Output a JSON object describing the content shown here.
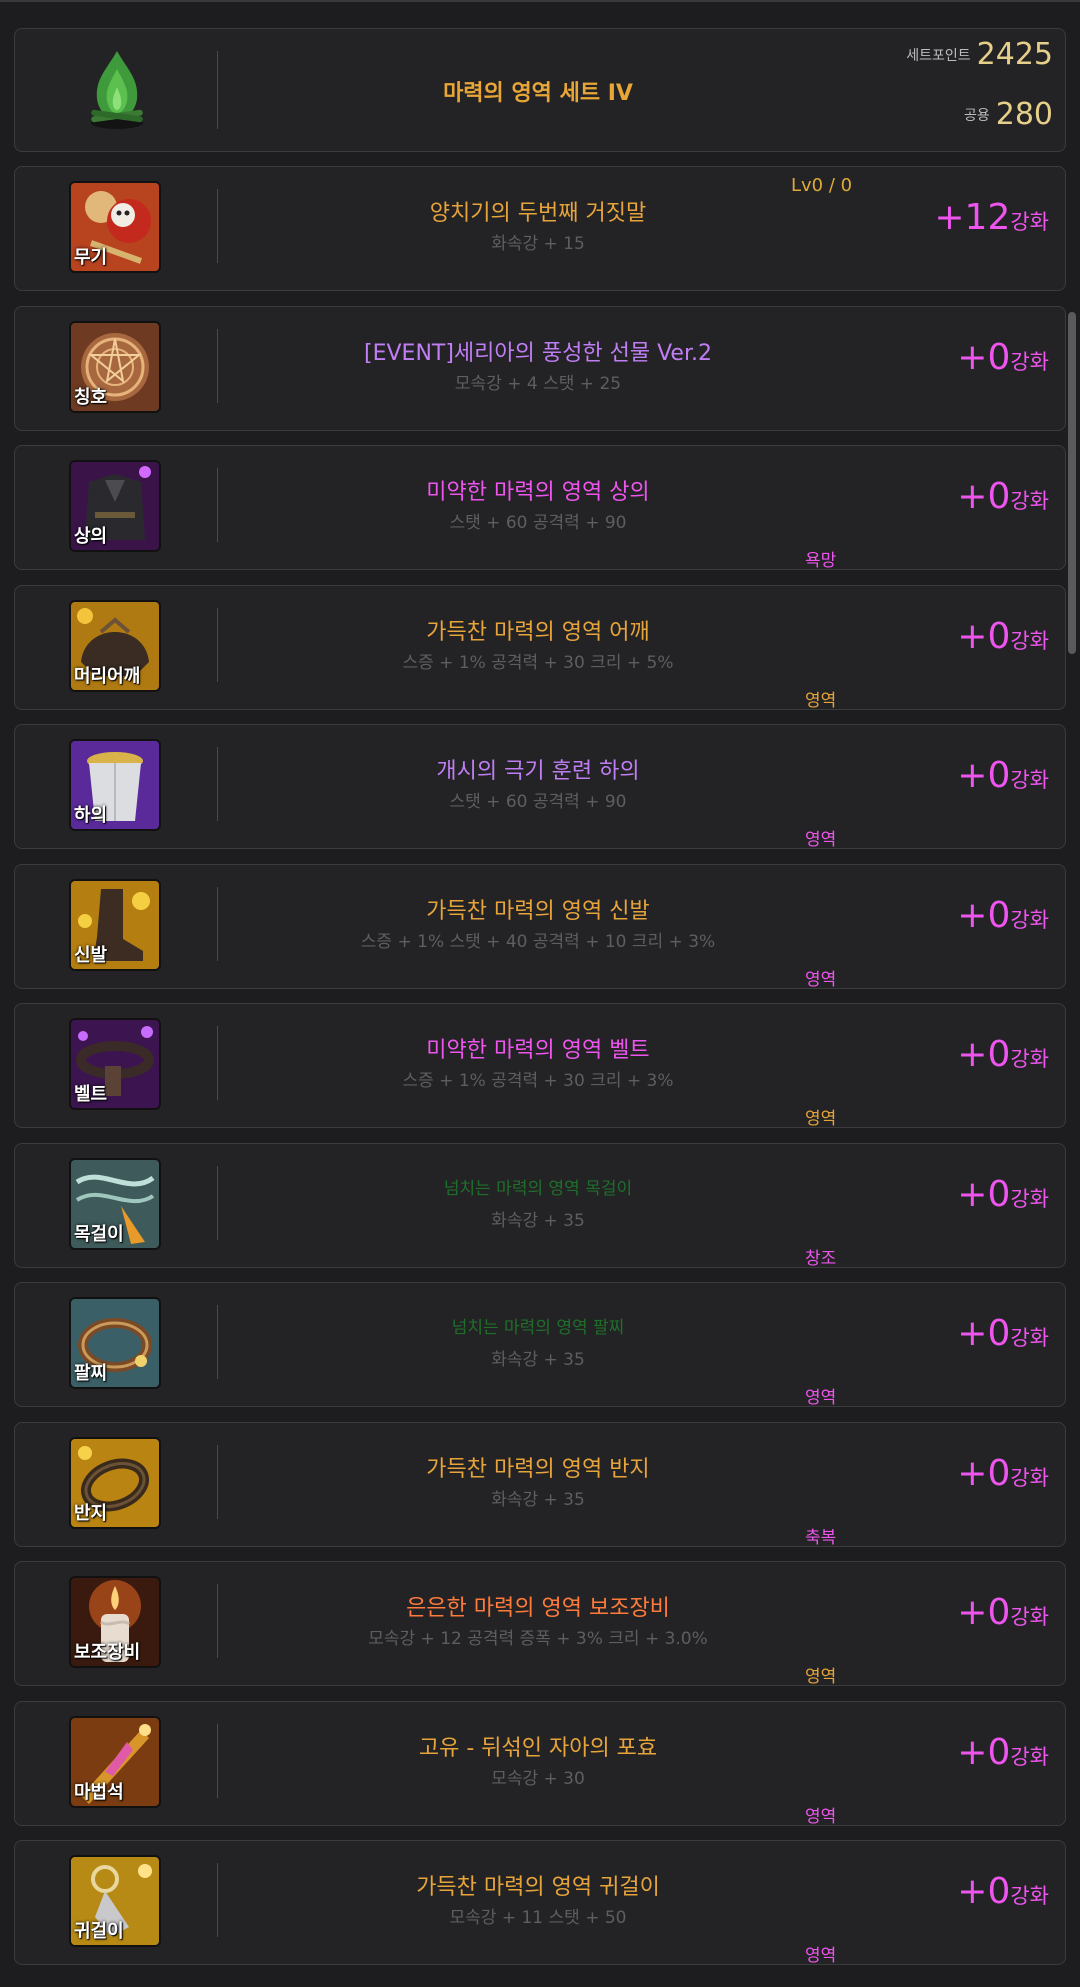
{
  "set": {
    "name": "마력의 영역 세트 IV",
    "set_point_label": "세트포인트",
    "set_point_value": "2425",
    "shared_label": "공용",
    "shared_value": "280"
  },
  "level_badge": "Lv0 / 0",
  "enh_suffix": "강화",
  "items": [
    {
      "slot": "무기",
      "name": "양치기의 두번째 거짓말",
      "stats": "화속강 + 15",
      "enh": "+12",
      "emblem": ""
    },
    {
      "slot": "칭호",
      "name": "[EVENT]세리아의 풍성한 선물 Ver.2",
      "stats": "모속강 + 4 스탯 + 25",
      "enh": "+0",
      "emblem": ""
    },
    {
      "slot": "상의",
      "name": "미약한 마력의 영역 상의",
      "stats": "스탯 + 60 공격력 + 90",
      "enh": "+0",
      "emblem": "욕망"
    },
    {
      "slot": "머리어깨",
      "name": "가득찬 마력의 영역 어깨",
      "stats": "스증 + 1% 공격력 + 30 크리 + 5%",
      "enh": "+0",
      "emblem": "영역"
    },
    {
      "slot": "하의",
      "name": "개시의 극기 훈련 하의",
      "stats": "스탯 + 60 공격력 + 90",
      "enh": "+0",
      "emblem": "영역"
    },
    {
      "slot": "신발",
      "name": "가득찬 마력의 영역 신발",
      "stats": "스증 + 1% 스탯 + 40 공격력 + 10 크리 + 3%",
      "enh": "+0",
      "emblem": "영역"
    },
    {
      "slot": "벨트",
      "name": "미약한 마력의 영역 벨트",
      "stats": "스증 + 1% 공격력 + 30 크리 + 3%",
      "enh": "+0",
      "emblem": "영역"
    },
    {
      "slot": "목걸이",
      "name": "넘치는 마력의 영역 목걸이",
      "stats": "화속강 + 35",
      "enh": "+0",
      "emblem": "창조"
    },
    {
      "slot": "팔찌",
      "name": "넘치는 마력의 영역 팔찌",
      "stats": "화속강 + 35",
      "enh": "+0",
      "emblem": "영역"
    },
    {
      "slot": "반지",
      "name": "가득찬 마력의 영역 반지",
      "stats": "화속강 + 35",
      "enh": "+0",
      "emblem": "축복"
    },
    {
      "slot": "보조장비",
      "name": "은은한 마력의 영역 보조장비",
      "stats": "모속강 + 12 공격력 증폭 + 3% 크리 + 3.0%",
      "enh": "+0",
      "emblem": "영역"
    },
    {
      "slot": "마법석",
      "name": "고유 - 뒤섞인 자아의 포효",
      "stats": "모속강 + 30",
      "enh": "+0",
      "emblem": "영역"
    },
    {
      "slot": "귀걸이",
      "name": "가득찬 마력의 영역 귀걸이",
      "stats": "모속강 + 11 스탯 + 50",
      "enh": "+0",
      "emblem": "영역"
    }
  ],
  "colors": {
    "accent_enhance": "#ee55ee",
    "unique_name": "#e7a43a",
    "epic_name": "#c07ef5",
    "rare_name": "#ee55ee",
    "legacy_name": "#1f6f2a",
    "set_points": "#e6cf8a"
  }
}
